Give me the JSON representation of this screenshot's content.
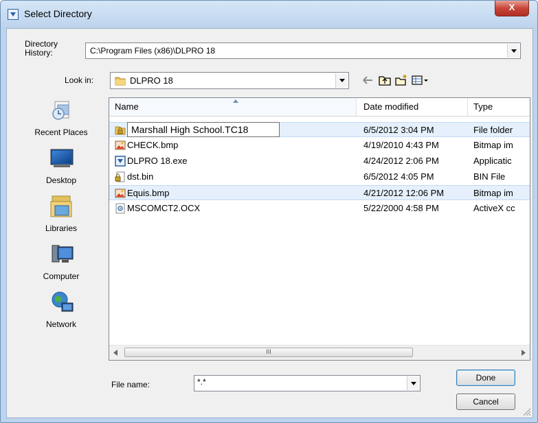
{
  "window": {
    "title": "Select Directory",
    "close_label": "X"
  },
  "history": {
    "label": "Directory\nHistory:",
    "label_line1": "Directory",
    "label_line2": "History:",
    "value": "C:\\Program Files (x86)\\DLPRO 18"
  },
  "lookin": {
    "label": "Look in:",
    "value": "DLPRO 18"
  },
  "places": [
    {
      "label": "Recent Places",
      "icon": "recent-places-icon"
    },
    {
      "label": "Desktop",
      "icon": "desktop-icon"
    },
    {
      "label": "Libraries",
      "icon": "libraries-icon"
    },
    {
      "label": "Computer",
      "icon": "computer-icon"
    },
    {
      "label": "Network",
      "icon": "network-icon"
    }
  ],
  "columns": {
    "name": "Name",
    "date": "Date modified",
    "type": "Type"
  },
  "files": [
    {
      "name": "Marshall High School.TC18",
      "date": "6/5/2012 3:04 PM",
      "type": "File folder",
      "icon": "folder-lock-icon",
      "renaming": true
    },
    {
      "name": "CHECK.bmp",
      "date": "4/19/2010 4:43 PM",
      "type": "Bitmap im",
      "icon": "bitmap-icon"
    },
    {
      "name": "DLPRO 18.exe",
      "date": "4/24/2012 2:06 PM",
      "type": "Applicatic",
      "icon": "application-icon"
    },
    {
      "name": "dst.bin",
      "date": "6/5/2012 4:05 PM",
      "type": "BIN File",
      "icon": "lock-file-icon"
    },
    {
      "name": "Equis.bmp",
      "date": "4/21/2012 12:06 PM",
      "type": "Bitmap im",
      "icon": "bitmap-icon",
      "selected": true
    },
    {
      "name": "MSCOMCT2.OCX",
      "date": "5/22/2000 4:58 PM",
      "type": "ActiveX cc",
      "icon": "activex-icon"
    }
  ],
  "scrollbar": {
    "grip": "III"
  },
  "filename": {
    "label": "File name:",
    "value": "*.*"
  },
  "buttons": {
    "done": "Done",
    "cancel": "Cancel"
  },
  "colors": {
    "accent": "#3c7fb1",
    "selection": "#e5f0fc",
    "title_bg": "#bcd4ef",
    "close": "#c8453a"
  }
}
